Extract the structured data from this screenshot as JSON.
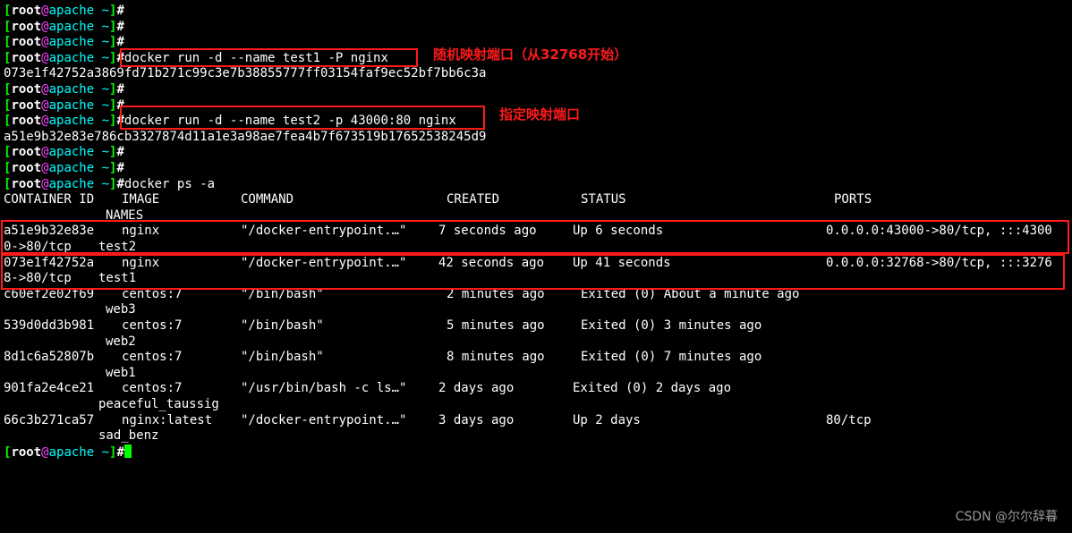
{
  "prompt": {
    "open": "[",
    "user": "root",
    "at": "@",
    "host": "apache",
    "path": " ~",
    "close": "]",
    "symbol": "#"
  },
  "commands": {
    "run1": "docker run -d --name test1 -P nginx",
    "run1_output": "073e1f42752a3869fd71b271c99c3e7b38855777ff03154faf9ec52bf7bb6c3a",
    "run2": "docker run -d --name test2 -p 43000:80 nginx",
    "run2_output": "a51e9b32e83e786cb3327874d11a1e3a98ae7fea4b7f673519b17652538245d9",
    "ps": "docker ps -a"
  },
  "annotations": {
    "run1_note": "随机映射端口（从32768开始）",
    "run2_note": "指定映射端口"
  },
  "table": {
    "headers": {
      "container_id": "CONTAINER ID",
      "image": "IMAGE",
      "command": "COMMAND",
      "created": "CREATED",
      "status": "STATUS",
      "ports": "PORTS",
      "names": "NAMES"
    },
    "rows": [
      {
        "id": "a51e9b32e83e",
        "image": "nginx",
        "command": "\"/docker-entrypoint.…\"",
        "created": "7 seconds ago",
        "status": "Up 6 seconds",
        "ports": "0.0.0.0:43000->80/tcp, :::4300",
        "ports_wrap": "0->80/tcp",
        "name": "test2"
      },
      {
        "id": "073e1f42752a",
        "image": "nginx",
        "command": "\"/docker-entrypoint.…\"",
        "created": "42 seconds ago",
        "status": "Up 41 seconds",
        "ports": "0.0.0.0:32768->80/tcp, :::3276",
        "ports_wrap": "8->80/tcp",
        "name": "test1"
      },
      {
        "id": "c60ef2e02f69",
        "image": "centos:7",
        "command": "\"/bin/bash\"",
        "created": "2 minutes ago",
        "status": "Exited (0) About a minute ago",
        "ports": "",
        "ports_wrap": "",
        "name": "web3"
      },
      {
        "id": "539d0dd3b981",
        "image": "centos:7",
        "command": "\"/bin/bash\"",
        "created": "5 minutes ago",
        "status": "Exited (0) 3 minutes ago",
        "ports": "",
        "ports_wrap": "",
        "name": "web2"
      },
      {
        "id": "8d1c6a52807b",
        "image": "centos:7",
        "command": "\"/bin/bash\"",
        "created": "8 minutes ago",
        "status": "Exited (0) 7 minutes ago",
        "ports": "",
        "ports_wrap": "",
        "name": "web1"
      },
      {
        "id": "901fa2e4ce21",
        "image": "centos:7",
        "command": "\"/usr/bin/bash -c ls…\"",
        "created": "2 days ago",
        "status": "Exited (0) 2 days ago",
        "ports": "",
        "ports_wrap": "",
        "name": "peaceful_taussig"
      },
      {
        "id": "66c3b271ca57",
        "image": "nginx:latest",
        "command": "\"/docker-entrypoint.…\"",
        "created": "3 days ago",
        "status": "Up 2 days",
        "ports": "80/tcp",
        "ports_wrap": "",
        "name": "sad_benz"
      }
    ]
  },
  "watermark": "CSDN @尔尔辞暮",
  "colors": {
    "background": "#000000",
    "prompt_bracket": "#00ff00",
    "prompt_user": "#ffffff",
    "prompt_at": "#ff40ff",
    "prompt_host": "#00ffff",
    "annotation": "#ff1a1a",
    "cursor": "#00ff00"
  }
}
